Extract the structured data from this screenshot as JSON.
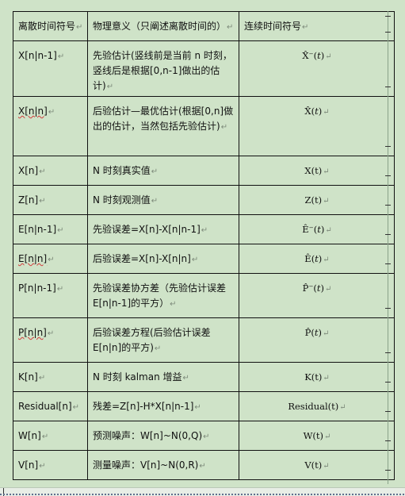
{
  "table": {
    "headers": [
      "离散时间符号",
      "物理意义（只阐述离散时间的）",
      "连续时间符号"
    ],
    "rows": [
      {
        "sym": "X[n|n-1]",
        "meaning": "先验估计(竖线前是当前 n 时刻，竖线后是根据[0,n-1]做出的估计)",
        "cont": "X̂⁻(𝑡)"
      },
      {
        "sym": "X[n|n]",
        "meaning": "后验估计—最优估计(根据[0,n]做出的估计，当然包括先验估计)",
        "cont": "X̂(𝑡)"
      },
      {
        "sym": "X[n]",
        "meaning": "N 时刻真实值",
        "cont": "X(t)"
      },
      {
        "sym": "Z[n]",
        "meaning": "N 时刻观测值",
        "cont": "Z(t)"
      },
      {
        "sym": "E[n|n-1]",
        "meaning": "先验误差=X[n]-X[n|n-1]",
        "cont": "Ê⁻(𝑡)"
      },
      {
        "sym": "E[n|n]",
        "meaning": "后验误差=X[n]-X[n|n]",
        "cont": "Ê(𝑡)"
      },
      {
        "sym": "P[n|n-1]",
        "meaning": "先验误差协方差（先验估计误差E[n|n-1]的平方）",
        "cont": "P̂⁻(𝑡)"
      },
      {
        "sym": "P[n|n]",
        "meaning": "后验误差方程(后验估计误差E[n|n]的平方)",
        "cont": "P̂(𝑡)"
      },
      {
        "sym": "K[n]",
        "meaning": "N 时刻 kalman 增益",
        "cont": "K(t)"
      },
      {
        "sym": "Residual[n]",
        "meaning": "残差=Z[n]-H*X[n|n-1]",
        "cont": "Residual(t)"
      },
      {
        "sym": "W[n]",
        "meaning": "预测噪声：W[n]~N(0,Q)",
        "cont": "W(t)"
      },
      {
        "sym": "V[n]",
        "meaning": "测量噪声：V[n]~N(0,R)",
        "cont": "V(t)"
      }
    ]
  },
  "paragraph_mark": "↵"
}
